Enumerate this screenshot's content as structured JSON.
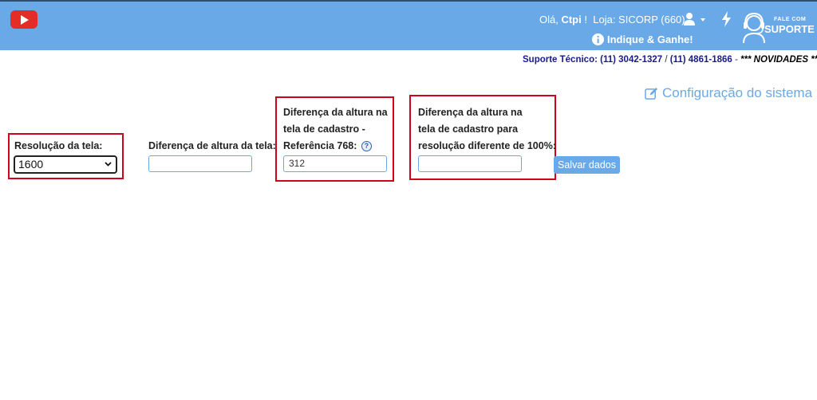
{
  "header": {
    "greeting_prefix": "Olá,",
    "user_name": "Ctpi",
    "greeting_suffix": "!",
    "store": "Loja: SICORP (660)",
    "indique": "Indique & Ganhe!",
    "fale_com": "FALE COM",
    "suporte": "SUPORTE",
    "colors": {
      "bar": "#6aa9e8",
      "youtube": "#e52d27"
    },
    "icons": [
      "youtube-icon",
      "user-icon",
      "caret-down-icon",
      "bolt-icon",
      "info-icon",
      "headset-icon"
    ]
  },
  "support_line": {
    "label": "Suporte Técnico:",
    "phone1": "(11) 3042-1327",
    "separator": "/",
    "phone2": "(11) 4861-1866",
    "dash": "-",
    "news": "*** NOVIDADES ***"
  },
  "page": {
    "title": "Configuração do sistema",
    "title_icon": "edit-icon"
  },
  "form": {
    "resolution": {
      "label": "Resolução da tela:",
      "selected": "1600"
    },
    "height_diff": {
      "label": "Diferença de altura da tela:",
      "value": ""
    },
    "height_ref": {
      "line1": "Diferença da altura na",
      "line2": "tela de cadastro -",
      "line3": "Referência 768:",
      "help_icon": "?",
      "value": "312"
    },
    "height_res": {
      "line1": "Diferença da altura na",
      "line2": "tela de cadastro para",
      "line3": "resolução diferente de 100%:",
      "value": ""
    },
    "save_label": "Salvar dados",
    "highlight_color": "#d0021b"
  }
}
